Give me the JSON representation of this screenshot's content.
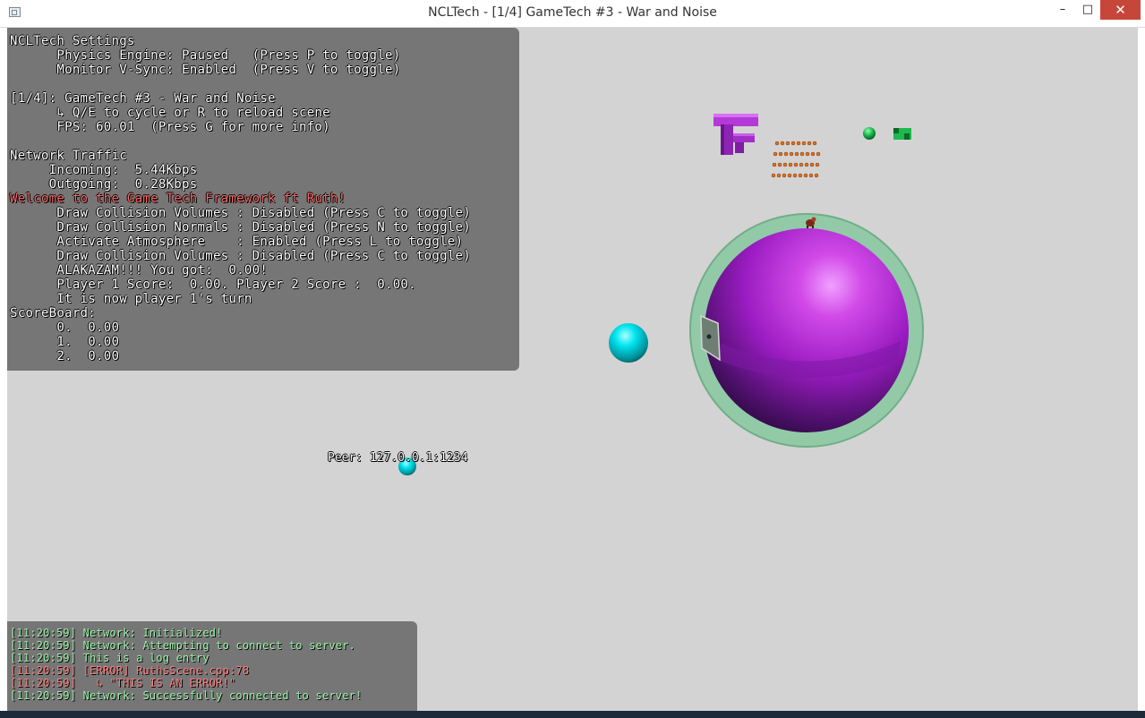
{
  "window": {
    "title": "NCLTech - [1/4] GameTech #3 - War and Noise",
    "minimize": "–",
    "maximize": "□",
    "close": "✕"
  },
  "settings": {
    "lines": [
      "NCLTech Settings",
      "      Physics Engine: Paused   (Press P to toggle)",
      "      Monitor V-Sync: Enabled  (Press V to toggle)",
      "",
      "[1/4]: GameTech #3 - War and Noise",
      "      ↳ Q/E to cycle or R to reload scene",
      "      FPS: 60.01  (Press G for more info)",
      "",
      "Network Traffic",
      "     Incoming:  5.44Kbps",
      "     Outgoing:  0.28Kbps",
      "Welcome to the Game Tech Framework ft Ruth!",
      "      Draw Collision Volumes : Disabled (Press C to toggle)",
      "      Draw Collision Normals : Disabled (Press N to toggle)",
      "      Activate Atmosphere    : Enabled (Press L to toggle)",
      "      Draw Collision Volumes : Disabled (Press C to toggle)",
      "      ALAKAZAM!!! You got:  0.00!",
      "      Player 1 Score:  0.00. Player 2 Score :  0.00.",
      "      It is now player 1's turn",
      "ScoreBoard:",
      "      0.  0.00",
      "      1.  0.00",
      "      2.  0.00"
    ]
  },
  "console": {
    "lines": [
      "[11:20:59] Network: Initialized!",
      "[11:20:59] Network: Attempting to connect to server.",
      "[11:20:59] This is a log entry",
      "[11:20:59] [ERROR] RuthsScene.cpp:78",
      "[11:20:59]   ↳ \"THIS IS AN ERROR!\"",
      "[11:20:59] Network: Successfully connected to server!"
    ]
  },
  "peer_label": "Peer: 127.0.0.1:1234",
  "colors": {
    "viewport_bg": "#d3d3d3",
    "overlay_bg": "#5c5c5c",
    "text_white": "#ffffff",
    "text_red": "#ff6b6b",
    "console_green": "#9cf2a8",
    "console_red": "#ff7e7e",
    "planet_purple": "#a020c8",
    "atmosphere_green": "#7fc89a",
    "cyan_ball": "#00d8e0"
  }
}
